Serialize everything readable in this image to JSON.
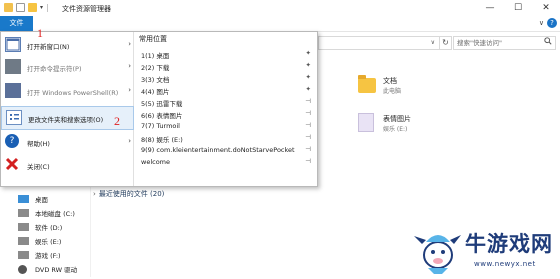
{
  "window": {
    "title": "文件资源管理器",
    "minimize": "—",
    "maximize": "☐",
    "close": "✕"
  },
  "ribbon": {
    "file_tab": "文件",
    "collapse": "∨",
    "help": "?"
  },
  "address_bar": {
    "dropdown": "∨",
    "refresh": "↻"
  },
  "search": {
    "placeholder": "搜索\"快速访问\"",
    "icon": "search-icon"
  },
  "file_menu": {
    "left_items": [
      {
        "label": "打开新窗口(N)",
        "icon": "new-window-icon",
        "submenu": true,
        "enabled": true
      },
      {
        "label": "打开命令提示符(P)",
        "icon": "command-prompt-icon",
        "submenu": true,
        "enabled": false
      },
      {
        "label": "打开 Windows PowerShell(R)",
        "icon": "powershell-icon",
        "submenu": true,
        "enabled": false
      },
      {
        "label": "更改文件夹和搜索选项(O)",
        "icon": "folder-options-icon",
        "submenu": false,
        "enabled": true,
        "highlighted": true
      },
      {
        "label": "帮助(H)",
        "icon": "help-icon",
        "submenu": true,
        "enabled": true
      },
      {
        "label": "关闭(C)",
        "icon": "close-icon",
        "submenu": false,
        "enabled": true
      }
    ],
    "recent_title": "常用位置",
    "recent_items": [
      {
        "label": "1(1)  桌面",
        "pinned": true
      },
      {
        "label": "2(2)  下载",
        "pinned": true
      },
      {
        "label": "3(3)  文档",
        "pinned": true
      },
      {
        "label": "4(4)  图片",
        "pinned": true
      },
      {
        "label": "5(5)  迅雷下载",
        "pinned": false
      },
      {
        "label": "6(6)  表情图片",
        "pinned": false
      },
      {
        "label": "7(7)  Turmoil",
        "pinned": false
      },
      {
        "label": "8(8)  娱乐 (E:)",
        "pinned": false
      },
      {
        "label": "9(9)  com.kleientertainment.doNotStarvePocket",
        "pinned": false
      },
      {
        "label": "      welcome",
        "pinned": false
      }
    ],
    "pin_symbol": "📌",
    "unpin_symbol": "⊣"
  },
  "annotations": {
    "one": "1",
    "two": "2"
  },
  "content": {
    "folders": [
      {
        "name": "文档",
        "sub": "此电脑"
      },
      {
        "name": "表情图片",
        "sub": "娱乐 (E:)"
      }
    ],
    "recent_group": "最近使用的文件 (20)",
    "recent_chevron": "›"
  },
  "sidebar": {
    "items": [
      {
        "label": "桌面",
        "icon": "desktop-icon"
      },
      {
        "label": "本地磁盘 (C:)",
        "icon": "drive-icon"
      },
      {
        "label": "软件 (D:)",
        "icon": "drive-icon"
      },
      {
        "label": "娱乐 (E:)",
        "icon": "drive-icon"
      },
      {
        "label": "游戏 (F:)",
        "icon": "drive-icon"
      },
      {
        "label": "DVD RW 驱动",
        "icon": "dvd-drive-icon"
      }
    ]
  },
  "watermark": {
    "text": "牛游戏网",
    "url": "www.newyx.net"
  },
  "colors": {
    "accent": "#1979ca",
    "highlight_bg": "#e6f0fa",
    "annotation_red": "#e02020",
    "folder_yellow": "#f6c442"
  }
}
